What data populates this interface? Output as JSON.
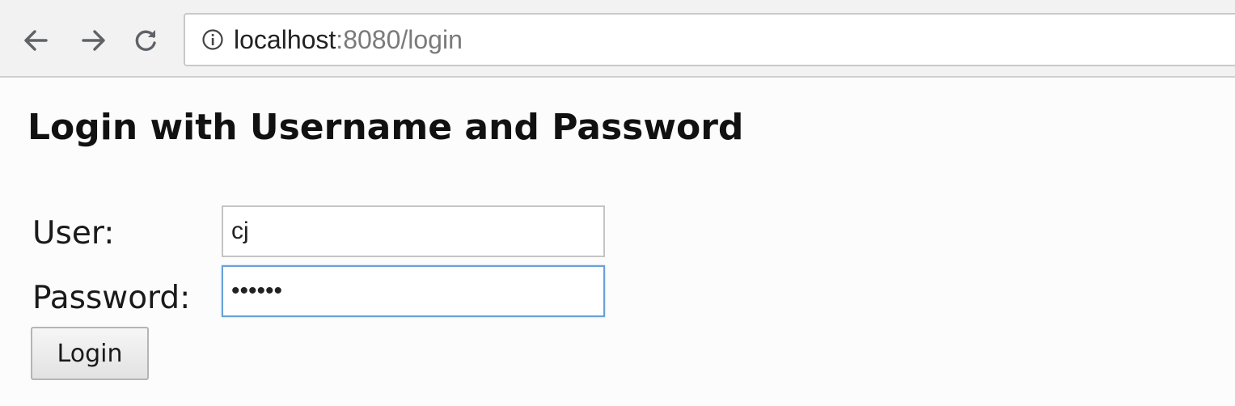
{
  "browser": {
    "url_host": "localhost",
    "url_rest": ":8080/login"
  },
  "page": {
    "title": "Login with Username and Password"
  },
  "form": {
    "user_label": "User:",
    "user_value": "cj",
    "password_label": "Password:",
    "password_value": "••••••",
    "login_label": "Login"
  },
  "colors": {
    "focus_border": "#6aa0d8",
    "url_host": "#222222",
    "url_rest": "#7a7a7a"
  },
  "icons": {
    "back": "arrow-left",
    "forward": "arrow-right",
    "reload": "reload",
    "info": "info-circle"
  }
}
